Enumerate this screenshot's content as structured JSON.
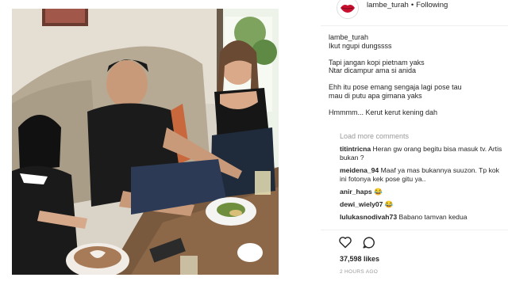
{
  "header": {
    "username": "lambe_turah",
    "separator": "•",
    "follow_status": "Following"
  },
  "caption": {
    "username": "lambe_turah",
    "lines": [
      "Ikut ngupi dungssss",
      "",
      "Tapi jangan kopi pietnam yaks",
      "Ntar dicampur ama si anida",
      "",
      "Ehh itu pose emang sengaja lagi pose tau",
      "mau di putu apa gimana yaks",
      "",
      "Hmmmm... Kerut kerut kening dah"
    ]
  },
  "load_more_label": "Load more comments",
  "comments": [
    {
      "user": "titintricna",
      "text": "Heran gw orang begitu bisa masuk tv. Artis bukan ?"
    },
    {
      "user": "meidena_94",
      "text": "Maaf ya mas bukannya suuzon. Tp kok ini fotonya kek pose gitu ya.."
    },
    {
      "user": "anir_haps",
      "text": "😂"
    },
    {
      "user": "dewi_wiely07",
      "text": "😂"
    },
    {
      "user": "lulukasnodivah73",
      "text": "Babano tamvan kedua"
    }
  ],
  "actions": {
    "like_icon": "heart-outline-icon",
    "comment_icon": "speech-bubble-icon"
  },
  "likes_text": "37,598 likes",
  "timestamp": "2 HOURS AGO",
  "colors": {
    "text": "#262626",
    "muted": "#999999",
    "divider": "#efefef",
    "avatar_lips": "#c8102e"
  }
}
